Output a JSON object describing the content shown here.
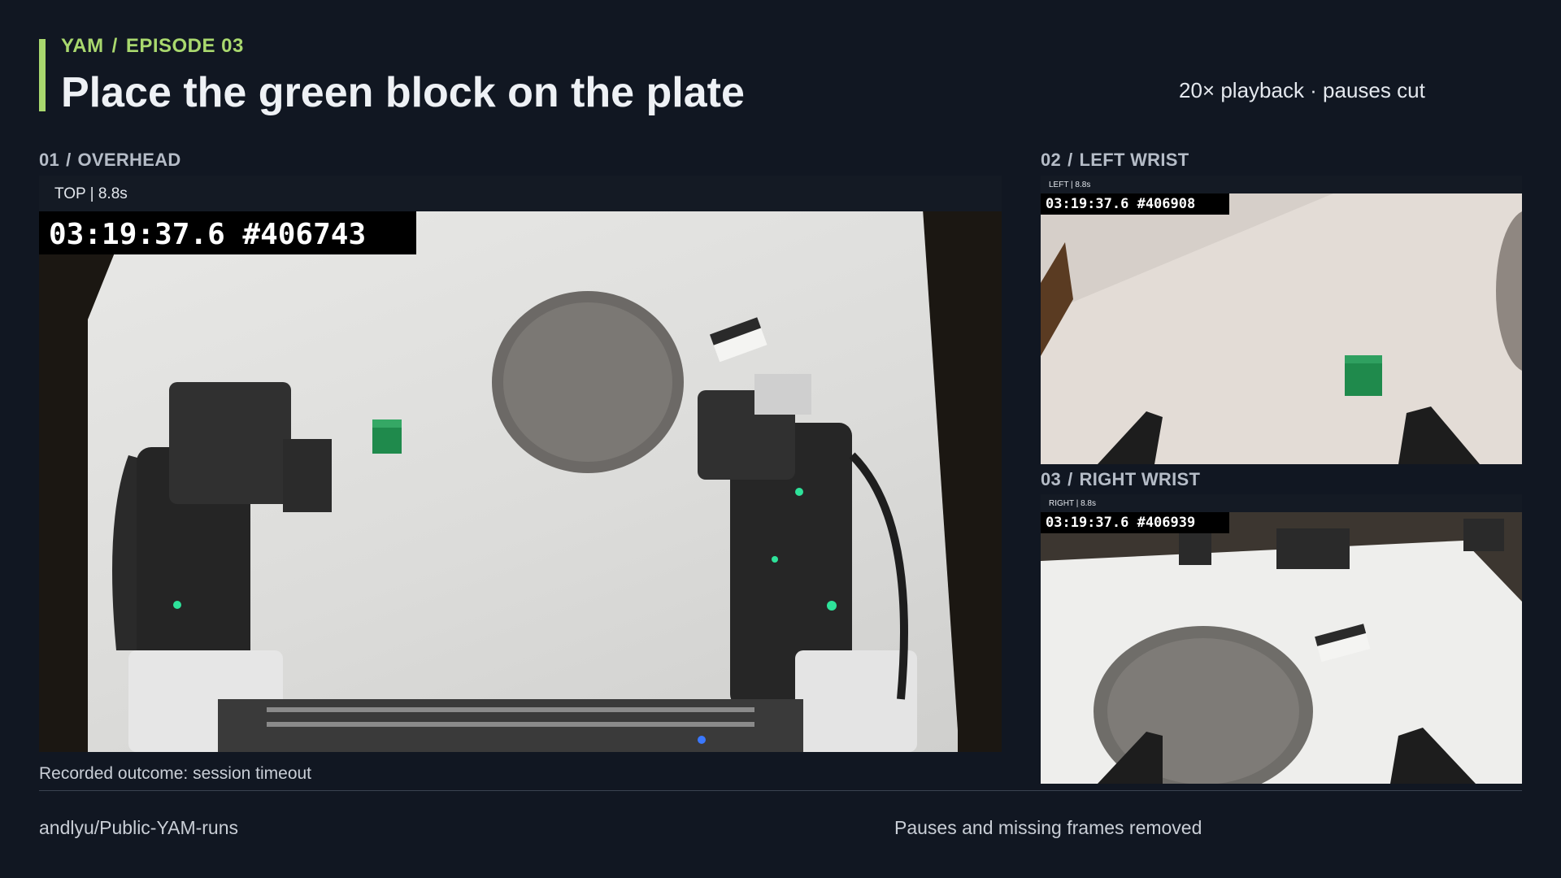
{
  "header": {
    "project": "YAM",
    "episode": "EPISODE 03",
    "title": "Place the green block on the plate",
    "playback_note": "20× playback · pauses cut"
  },
  "panels": [
    {
      "index": "01",
      "name": "OVERHEAD",
      "strip_label": "TOP | 8.8s",
      "timestamp": "03:19:37.6 #406743"
    },
    {
      "index": "02",
      "name": "LEFT WRIST",
      "strip_label": "LEFT | 8.8s",
      "timestamp": "03:19:37.6 #406908"
    },
    {
      "index": "03",
      "name": "RIGHT WRIST",
      "strip_label": "RIGHT | 8.8s",
      "timestamp": "03:19:37.6 #406939"
    }
  ],
  "footer": {
    "outcome": "Recorded outcome: session timeout",
    "repo": "andlyu/Public-YAM-runs",
    "note": "Pauses and missing frames removed"
  },
  "colors": {
    "accent": "#a9d86e",
    "background": "#111722",
    "block": "#1f8a4c"
  }
}
